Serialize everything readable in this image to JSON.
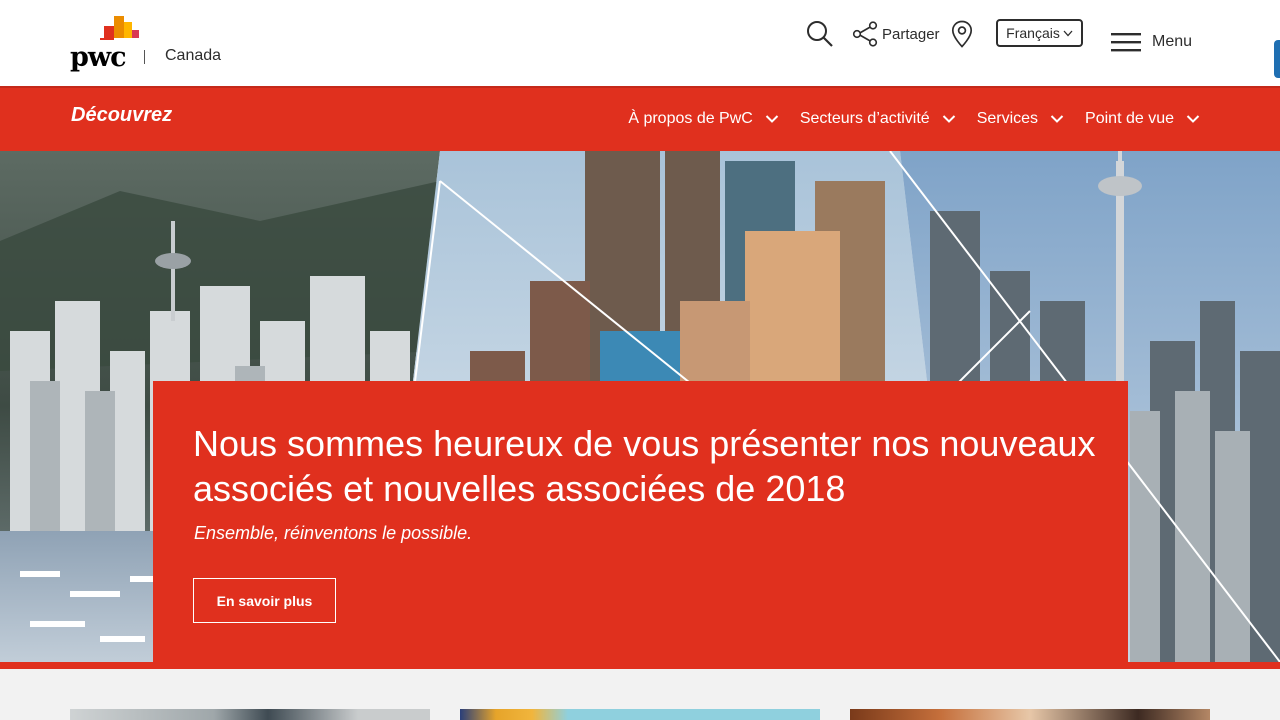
{
  "header": {
    "logo_text": "pwc",
    "country": "Canada",
    "share_label": "Partager",
    "language": "Français",
    "menu_label": "Menu"
  },
  "nav": {
    "title": "Découvrez",
    "items": [
      {
        "label": "À propos de PwC"
      },
      {
        "label": "Secteurs d’activité"
      },
      {
        "label": "Services"
      },
      {
        "label": "Point de vue"
      }
    ]
  },
  "hero": {
    "headline": "Nous sommes heureux de vous présenter nos nouveaux associés et nouvelles associées de 2018",
    "tagline": "Ensemble, réinventons le possible.",
    "cta_label": "En savoir plus"
  },
  "colors": {
    "brand_red": "#e0301e",
    "brand_orange": "#eb8c00",
    "text_dark": "#2d2d2d"
  }
}
